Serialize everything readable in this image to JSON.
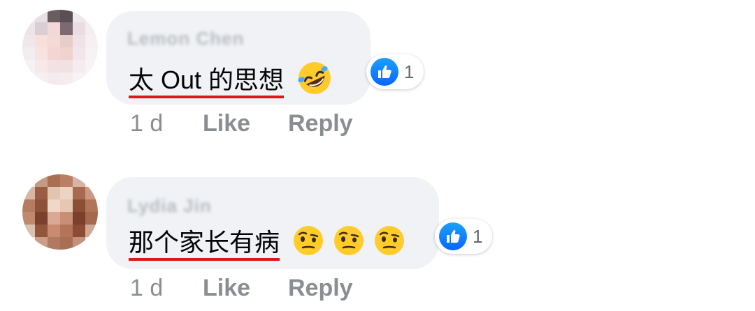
{
  "comments": [
    {
      "author": "Lemon Chen",
      "text": "太 Out 的思想",
      "emojis": [
        "rolling-on-floor-laughing-emoji"
      ],
      "reaction_icon": "thumbs-up-icon",
      "reaction_count": "1",
      "time": "1 d",
      "like_label": "Like",
      "reply_label": "Reply"
    },
    {
      "author": "Lydia Jin",
      "text": "那个家长有病",
      "emojis": [
        "face-with-raised-eyebrow-emoji",
        "face-with-raised-eyebrow-emoji",
        "face-with-raised-eyebrow-emoji"
      ],
      "reaction_icon": "thumbs-up-icon",
      "reaction_count": "1",
      "time": "1 d",
      "like_label": "Like",
      "reply_label": "Reply"
    }
  ],
  "colors": {
    "bubble": "#f0f2f5",
    "underline": "#e0161c",
    "like_blue": "#0866ff",
    "meta_text": "#8a8d91"
  }
}
